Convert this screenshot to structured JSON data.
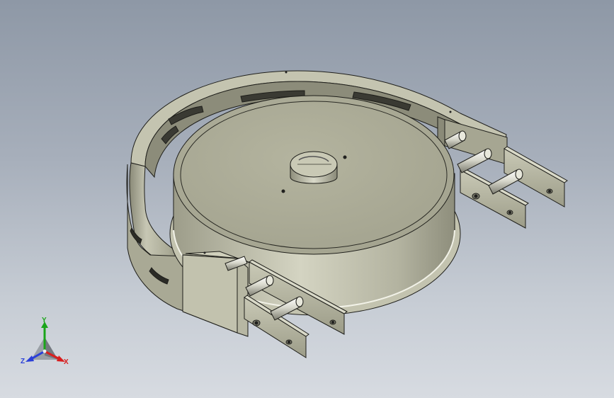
{
  "triad": {
    "x_label": "X",
    "y_label": "Y",
    "z_label": "Z",
    "x_color": "#d81e1e",
    "y_color": "#1aa51a",
    "z_color": "#2a3fd8"
  },
  "scene": {
    "background_top": "#8e98a6",
    "background_bottom": "#d7dbe1",
    "part_color": "#b9b9a4",
    "part_shadow": "#7d7d6c",
    "edge_color": "#1e1e1a"
  }
}
